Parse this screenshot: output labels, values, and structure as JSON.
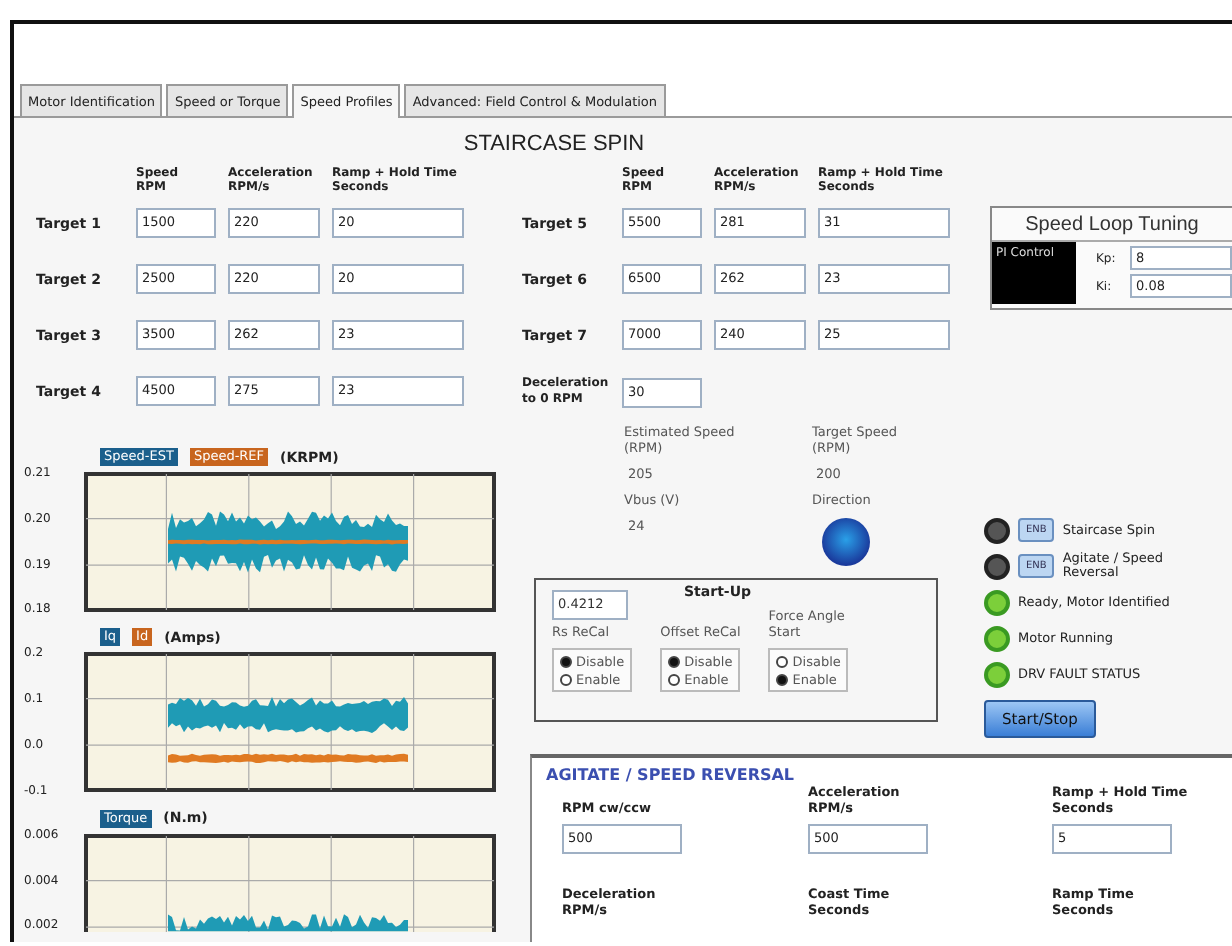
{
  "tabs": [
    {
      "label": "Motor Identification",
      "selected": false
    },
    {
      "label": "Speed or Torque",
      "selected": false
    },
    {
      "label": "Speed Profiles",
      "selected": true
    },
    {
      "label": "Advanced: Field Control & Modulation",
      "selected": false
    }
  ],
  "title": "STAIRCASE SPIN",
  "column_headers_left": [
    {
      "text": "Speed\nRPM"
    },
    {
      "text": "Acceleration\nRPM/s"
    },
    {
      "text": "Ramp + Hold Time\nSeconds"
    }
  ],
  "column_headers_right": [
    {
      "text": "Speed\nRPM"
    },
    {
      "text": "Acceleration\nRPM/s"
    },
    {
      "text": "Ramp + Hold Time\nSeconds"
    }
  ],
  "targets_left": [
    {
      "label": "Target 1",
      "speed": "1500",
      "acceleration": "220",
      "ramp_hold_time": "20"
    },
    {
      "label": "Target 2",
      "speed": "2500",
      "acceleration": "220",
      "ramp_hold_time": "20"
    },
    {
      "label": "Target 3",
      "speed": "3500",
      "acceleration": "262",
      "ramp_hold_time": "23"
    },
    {
      "label": "Target 4",
      "speed": "4500",
      "acceleration": "275",
      "ramp_hold_time": "23"
    }
  ],
  "targets_right": [
    {
      "label": "Target 5",
      "speed": "5500",
      "acceleration": "281",
      "ramp_hold_time": "31"
    },
    {
      "label": "Target 6",
      "speed": "6500",
      "acceleration": "262",
      "ramp_hold_time": "23"
    },
    {
      "label": "Target 7",
      "speed": "7000",
      "acceleration": "240",
      "ramp_hold_time": "25"
    }
  ],
  "deceleration": {
    "label": "Deceleration\nto 0 RPM",
    "value": "30"
  },
  "speed_loop_tuning": {
    "title": "Speed Loop Tuning",
    "mode": "PI Control",
    "kp": {
      "label": "Kp:",
      "value": "8"
    },
    "ki": {
      "label": "Ki:",
      "value": "0.08"
    }
  },
  "charts": [
    {
      "legend": [
        {
          "label": "Speed-EST",
          "color": "#1b5f8c"
        },
        {
          "label": "Speed-REF",
          "color": "#c8651e"
        }
      ],
      "unit": "(KRPM)",
      "y_ticks": [
        "0.21",
        "0.20",
        "0.19",
        "0.18"
      ]
    },
    {
      "legend": [
        {
          "label": "Iq",
          "color": "#1b5f8c"
        },
        {
          "label": "Id",
          "color": "#c8651e"
        }
      ],
      "unit": "(Amps)",
      "y_ticks": [
        "0.2",
        "0.1",
        "0.0",
        "-0.1"
      ]
    },
    {
      "legend": [
        {
          "label": "Torque",
          "color": "#1b5f8c"
        }
      ],
      "unit": "(N.m)",
      "y_ticks": [
        "0.006",
        "0.004",
        "0.002"
      ]
    }
  ],
  "readouts": [
    {
      "label": "Estimated Speed\n(RPM)",
      "value": "205"
    },
    {
      "label": "Target Speed\n(RPM)",
      "value": "200"
    }
  ],
  "vbus": {
    "label": "Vbus (V)",
    "value": "24"
  },
  "direction": {
    "label": "Direction"
  },
  "startup": {
    "title": "Start-Up",
    "value": "0.4212",
    "groups": [
      {
        "label": "Rs ReCal",
        "options": [
          {
            "label": "Disable",
            "selected": true
          },
          {
            "label": "Enable",
            "selected": false
          }
        ]
      },
      {
        "label": "Offset ReCal",
        "options": [
          {
            "label": "Disable",
            "selected": true
          },
          {
            "label": "Enable",
            "selected": false
          }
        ]
      },
      {
        "label": "Force Angle\nStart",
        "options": [
          {
            "label": "Disable",
            "selected": false
          },
          {
            "label": "Enable",
            "selected": true
          }
        ]
      }
    ]
  },
  "indicators": [
    {
      "kind": "toggle",
      "button": "ENB",
      "label": "Staircase Spin",
      "on": false
    },
    {
      "kind": "toggle",
      "button": "ENB",
      "label": "Agitate / Speed\nReversal",
      "on": false
    },
    {
      "kind": "led",
      "label": "Ready, Motor Identified",
      "on": true
    },
    {
      "kind": "led",
      "label": "Motor Running",
      "on": true
    },
    {
      "kind": "led",
      "label": "DRV FAULT STATUS",
      "on": true
    }
  ],
  "start_stop": "Start/Stop",
  "agitate": {
    "title": "AGITATE / SPEED REVERSAL",
    "fields": [
      {
        "label": "RPM cw/ccw",
        "value": "500"
      },
      {
        "label": "Acceleration\nRPM/s",
        "value": "500"
      },
      {
        "label": "Ramp + Hold Time\nSeconds",
        "value": "5"
      },
      {
        "label": "Deceleration\nRPM/s"
      },
      {
        "label": "Coast Time\nSeconds"
      },
      {
        "label": "Ramp Time\nSeconds"
      }
    ]
  }
}
